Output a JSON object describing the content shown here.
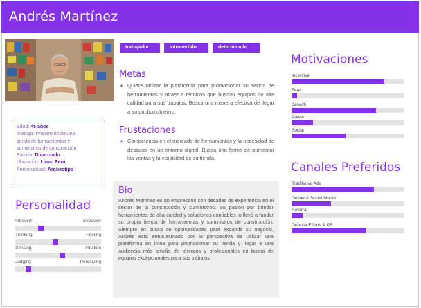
{
  "persona": {
    "name": "Andrés Martínez",
    "tags": [
      "trabajador",
      "introvertido",
      "determinado"
    ]
  },
  "info": {
    "edad_label": "Edad:",
    "edad": "45 años",
    "trabajo_label": "Trabajo:",
    "trabajo_line1": "Propietario de una",
    "trabajo_line2": "tienda de herramientas y",
    "trabajo_line3": "suministros de construcción",
    "familia_label": "Familia:",
    "familia": "Divorciado",
    "ubicacion_label": "Ubicación:",
    "ubicacion": "Lima, Perú",
    "personalidad_label": "Personalidad:",
    "personalidad": "Arqueotipo"
  },
  "metas": {
    "title": "Metas",
    "items": [
      "Quiere utilizar la plataforma para promocionar su tienda de herramientas y atraer a técnicos que buscan equipos de alta calidad para sus trabajos. Busca una manera efectiva de llegar a su público objetivo."
    ]
  },
  "frustraciones": {
    "title": "Frustaciones",
    "items": [
      "Competencia en el mercado de herramientas y la necesidad de destacar en un entorno digital. Busca una forma de aumentar las ventas y la visibilidad de su tienda."
    ]
  },
  "bio": {
    "title": "Bio",
    "text": "Andrés Martínez es un empresario con décadas de experiencia en el sector de la construcción y suministros. Su pasión por brindar herramientas de alta calidad y soluciones confiables lo llevó a fundar su propia tienda de herramientas y suministros de construcción. Siempre en busca de oportunidades para expandir su negocio, Andrés está entusiasmado por la perspectiva de utilizar una plataforma en línea para promocionar su tienda y llegar a una audiencia más amplia de técnicos y profesionales en busca de equipos excepcionales para sus trabajos."
  },
  "personalidad": {
    "title": "Personalidad",
    "sliders": [
      {
        "left": "Introvert",
        "right": "Extrovert",
        "value": 0.3
      },
      {
        "left": "Thinking",
        "right": "Feeling",
        "value": 0.47
      },
      {
        "left": "Sensing",
        "right": "Intuition",
        "value": 0.55
      },
      {
        "left": "Judging",
        "right": "Perceiving",
        "value": 0.15
      }
    ]
  },
  "motivaciones": {
    "title": "Motivaciones",
    "items": [
      {
        "label": "Incentive",
        "value": 0.82
      },
      {
        "label": "Fear",
        "value": 0.05
      },
      {
        "label": "Growth",
        "value": 0.75
      },
      {
        "label": "Power",
        "value": 0.19
      },
      {
        "label": "Social",
        "value": 0.48
      }
    ]
  },
  "canales": {
    "title": "Canales Preferidos",
    "items": [
      {
        "label": "Traditional Ads",
        "value": 0.73
      },
      {
        "label": "Online & Social Media",
        "value": 0.35
      },
      {
        "label": "Referral",
        "value": 0.1
      },
      {
        "label": "Guerilla Efforts & PR",
        "value": 0.66
      }
    ]
  },
  "colors": {
    "accent": "#8431e8",
    "track": "#e3e3e3",
    "bio_bg": "#efefef"
  }
}
